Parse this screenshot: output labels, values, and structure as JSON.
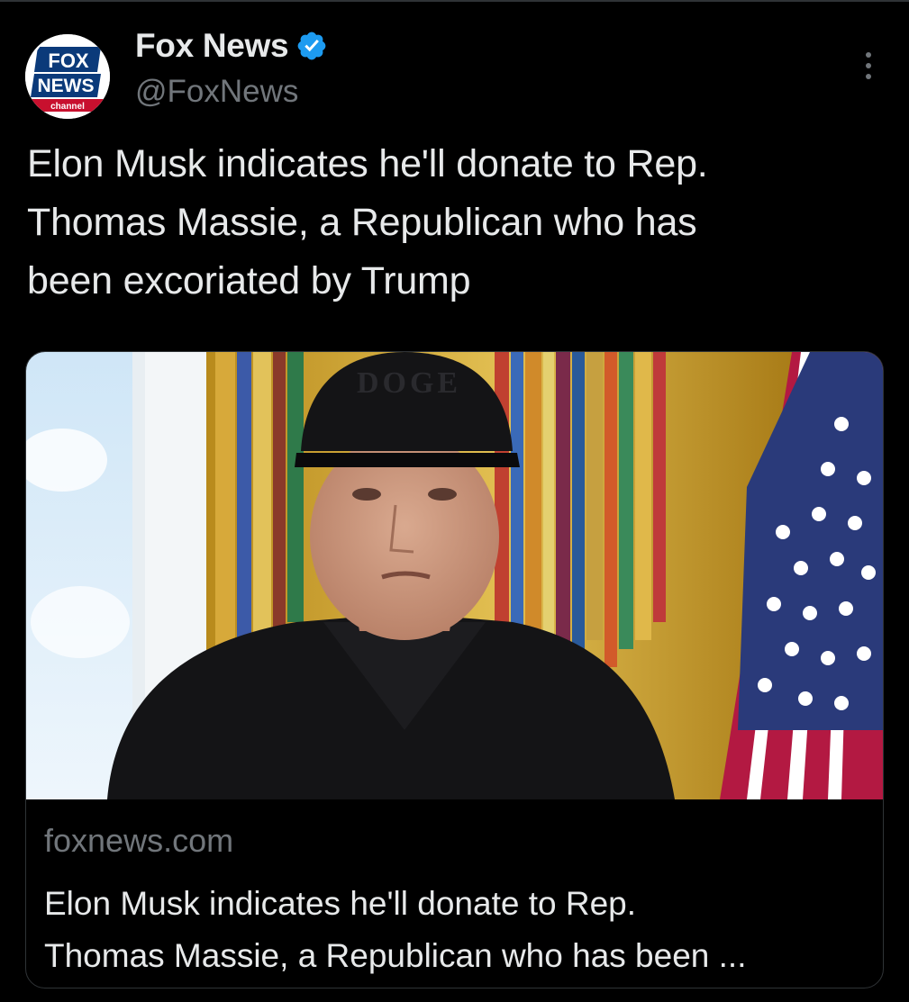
{
  "post": {
    "author": {
      "display_name": "Fox News",
      "handle": "@FoxNews",
      "verified": true,
      "avatar_logo_text": [
        "FOX",
        "NEWS",
        "channel"
      ]
    },
    "text_lines": [
      "Elon Musk indicates he'll donate to Rep.",
      "Thomas Massie, a Republican who has",
      "been excoriated by Trump"
    ],
    "more_icon": "more-vertical-icon"
  },
  "link_card": {
    "domain": "foxnews.com",
    "title_lines": [
      "Elon Musk indicates he'll donate to Rep.",
      "Thomas Massie, a Republican who has been ..."
    ],
    "image_cap_text": "DOGE"
  },
  "colors": {
    "background": "#000000",
    "primary_text": "#e7e9ea",
    "secondary_text": "#71767b",
    "verified_blue": "#1d9bf0",
    "border": "#2f3336",
    "fox_blue": "#0b3a7a",
    "fox_red": "#c8102e"
  }
}
